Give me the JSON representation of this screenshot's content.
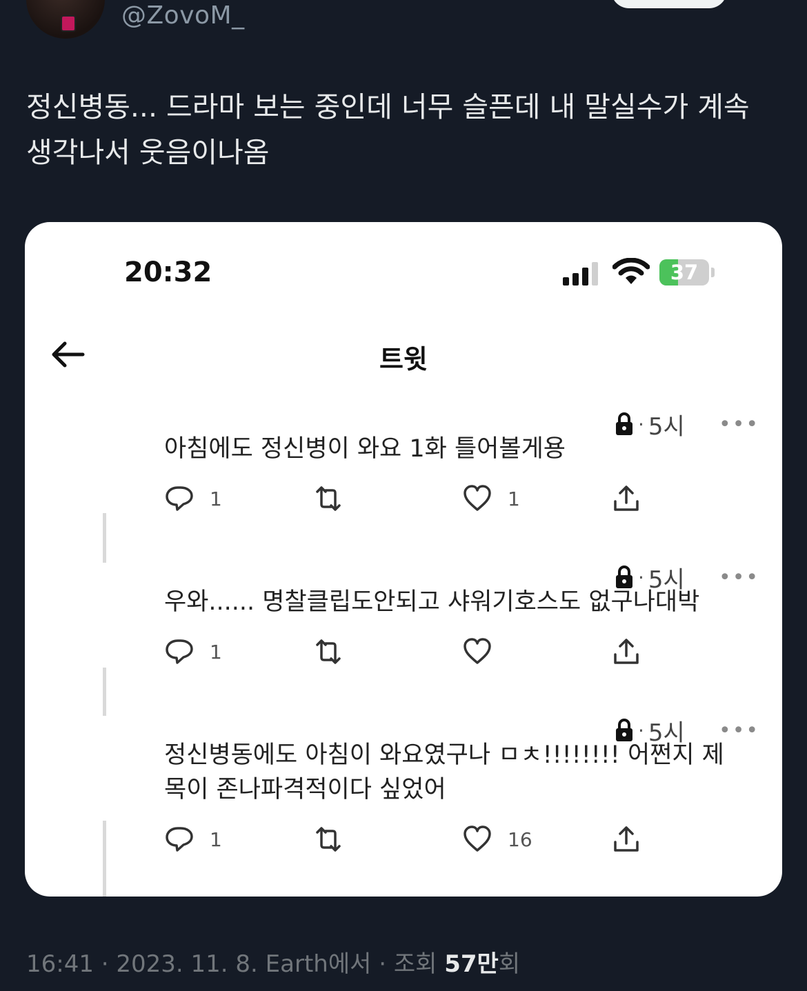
{
  "user": {
    "handle": "@ZovoM_"
  },
  "tweet": {
    "text_line1": "정신병동... 드라마 보는 중인데 너무 슬픈데 내 말실수가 계속",
    "text_line2": "생각나서 웃음이나옴"
  },
  "screenshot": {
    "status_bar": {
      "time": "20:32",
      "battery": "37",
      "battery_level_percent": 37
    },
    "header_title": "트윗",
    "posts": [
      {
        "time": "5시",
        "text_lines": [
          "아침에도 정신병이 와요 1화 틀어볼게용"
        ],
        "replies": "1",
        "retweets": "",
        "likes": "1"
      },
      {
        "time": "5시",
        "text_lines": [
          "우와...... 명찰클립도안되고 샤워기호스도 없구나대박"
        ],
        "replies": "1",
        "retweets": "",
        "likes": ""
      },
      {
        "time": "5시",
        "text_lines": [
          "정신병동에도 아침이 와요였구나 ㅁㅊ!!!!!!!! 어쩐지 제",
          "목이 존나파격적이다 싶었어"
        ],
        "replies": "1",
        "retweets": "",
        "likes": "16"
      }
    ]
  },
  "footer": {
    "timestamp": "16:41 · 2023. 11. 8. Earth에서 · 조회 ",
    "views": "57만",
    "views_suffix": "회"
  }
}
